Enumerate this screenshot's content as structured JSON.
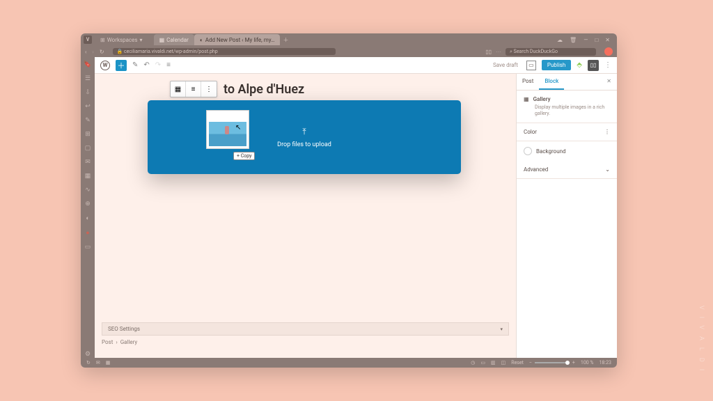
{
  "titlebar": {
    "workspaces_label": "Workspaces",
    "tab_inactive": "Calendar",
    "tab_active": "Add New Post ‹ My life, my…",
    "ctrl_min": "—",
    "ctrl_max": "□",
    "ctrl_close": "✕"
  },
  "addrbar": {
    "url": "ceciliamaria.vivaldi.net/wp-admin/post.php",
    "search_placeholder": "Search DuckDuckGo"
  },
  "wptop": {
    "save_draft": "Save draft",
    "publish": "Publish"
  },
  "editor": {
    "title_visible": "to Alpe d'Huez",
    "drop_label": "Drop files to upload",
    "copy_badge": "+ Copy",
    "seo_label": "SEO Settings"
  },
  "breadcrumb": {
    "a": "Post",
    "sep": "›",
    "b": "Gallery"
  },
  "sidebar": {
    "tab_post": "Post",
    "tab_block": "Block",
    "block_name": "Gallery",
    "block_desc": "Display multiple images in a rich gallery.",
    "color_label": "Color",
    "bg_label": "Background",
    "adv_label": "Advanced"
  },
  "statusbar": {
    "reset": "Reset",
    "zoom_pct": "100 %",
    "time": "18:23"
  },
  "brand": "V I V A L D I"
}
